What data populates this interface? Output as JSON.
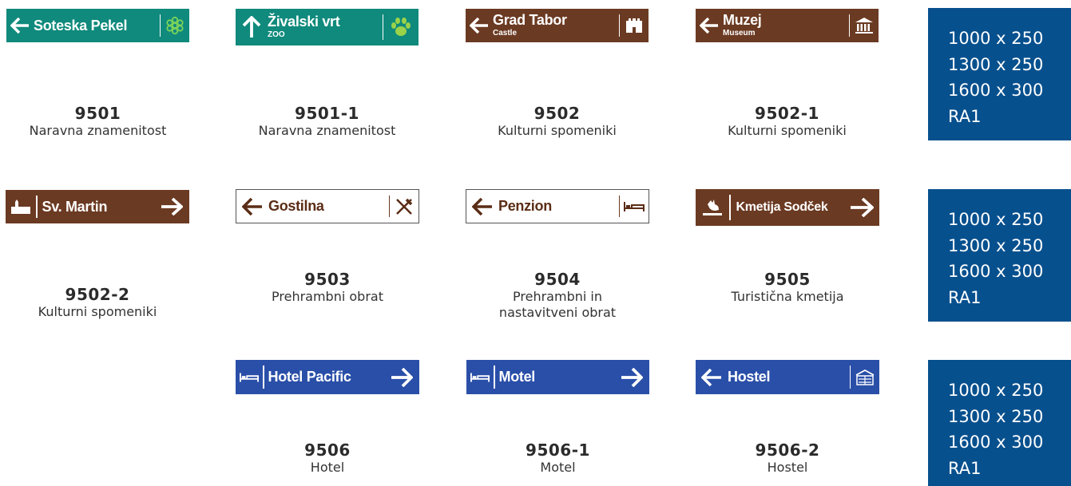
{
  "row1": {
    "s9501": {
      "title": "Soteska Pekel",
      "code": "9501",
      "desc": "Naravna znamenitost"
    },
    "s9501_1": {
      "title": "Živalski vrt",
      "sub": "ZOO",
      "code": "9501-1",
      "desc": "Naravna znamenitost"
    },
    "s9502": {
      "title": "Grad Tabor",
      "sub": "Castle",
      "code": "9502",
      "desc": "Kulturni spomeniki"
    },
    "s9502_1": {
      "title": "Muzej",
      "sub": "Museum",
      "code": "9502-1",
      "desc": "Kulturni spomeniki"
    }
  },
  "row2": {
    "s9502_2": {
      "title": "Sv. Martin",
      "code": "9502-2",
      "desc": "Kulturni spomeniki"
    },
    "s9503": {
      "title": "Gostilna",
      "code": "9503",
      "desc": "Prehrambni obrat"
    },
    "s9504": {
      "title": "Penzion",
      "code": "9504",
      "desc_line1": "Prehrambni in",
      "desc_line2": "nastavitveni obrat"
    },
    "s9505": {
      "title": "Kmetija Sodček",
      "code": "9505",
      "desc": "Turistična kmetija"
    }
  },
  "row3": {
    "s9506": {
      "title": "Hotel Pacific",
      "code": "9506",
      "desc": "Hotel"
    },
    "s9506_1": {
      "title": "Motel",
      "code": "9506-1",
      "desc": "Motel"
    },
    "s9506_2": {
      "title": "Hostel",
      "code": "9506-2",
      "desc": "Hostel"
    }
  },
  "sizes": {
    "line1": "1000 x 250",
    "line2": "1300 x 250",
    "line3": "1600 x 300",
    "line4": "RA1"
  },
  "colors": {
    "teal": "#0f8a7c",
    "brown": "#6b3a22",
    "blue": "#2a4fa8",
    "panel": "#07508e",
    "flower": "#7bd35a",
    "paw": "#9ad24a"
  },
  "icons": [
    "arrow-left-icon",
    "arrow-up-icon",
    "arrow-right-icon",
    "flower-icon",
    "paw-icon",
    "castle-icon",
    "museum-icon",
    "church-icon",
    "fork-knife-icon",
    "bed-icon",
    "rooster-icon",
    "hostel-icon"
  ]
}
